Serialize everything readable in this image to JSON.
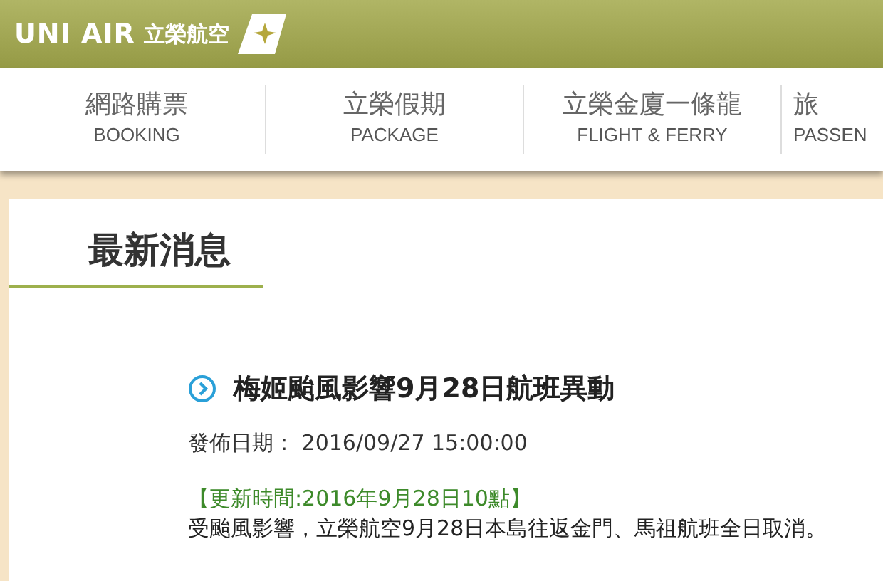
{
  "header": {
    "logo_latin": "UNI AIR",
    "logo_cjk": "立榮航空"
  },
  "nav": [
    {
      "label": "網路購票",
      "sub": "BOOKING"
    },
    {
      "label": "立榮假期",
      "sub": "PACKAGE"
    },
    {
      "label": "立榮金廈一條龍",
      "sub": "FLIGHT & FERRY"
    },
    {
      "label": "旅",
      "sub": "PASSEN"
    }
  ],
  "section_title": "最新消息",
  "article": {
    "title": "梅姬颱風影響9月28日航班異動",
    "date_label": "發佈日期：",
    "date": "2016/09/27 15:00:00",
    "update": "【更新時間:2016年9月28日10點】",
    "body": "受颱風影響，立榮航空9月28日本島往返金門、馬祖航班全日取消。"
  }
}
